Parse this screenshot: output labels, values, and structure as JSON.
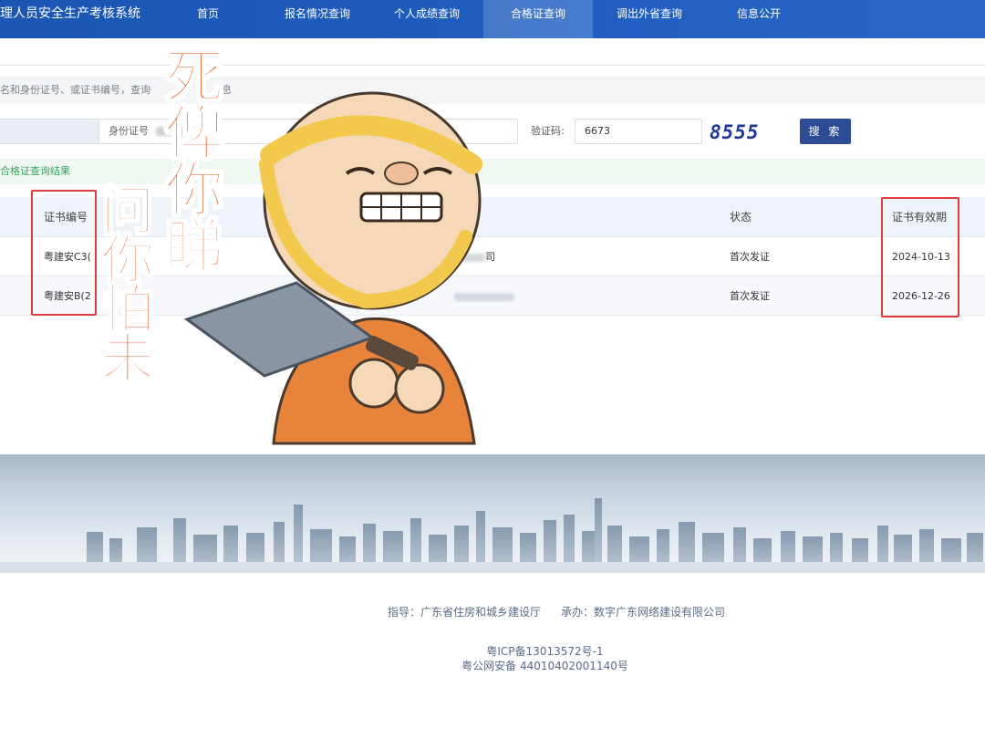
{
  "header": {
    "title": "理人员安全生产考核系统",
    "nav": [
      {
        "label": "首页",
        "active": false
      },
      {
        "label": "报名情况查询",
        "active": false
      },
      {
        "label": "个人成绩查询",
        "active": false
      },
      {
        "label": "合格证查询",
        "active": true
      },
      {
        "label": "调出外省查询",
        "active": false
      },
      {
        "label": "信息公开",
        "active": false
      }
    ]
  },
  "search": {
    "hint": "名和身份证号、或证书编号，查询",
    "hint_tail": "息",
    "id_field_prefix": "身份证号",
    "captcha_label": "验证码:",
    "captcha_value": "6673",
    "captcha_image_text": "8555",
    "search_button": "搜 索"
  },
  "result": {
    "banner": "合格证查询结果",
    "columns": {
      "cert_no": "证书编号",
      "status": "状态",
      "valid_until": "证书有效期"
    },
    "rows": [
      {
        "cert_no": "粤建安C3(",
        "company_tail": "司",
        "status": "首次发证",
        "valid_until": "2024-10-13"
      },
      {
        "cert_no": "粤建安B(2",
        "company_tail": "",
        "status": "首次发证",
        "valid_until": "2026-12-26"
      }
    ]
  },
  "meme": {
    "big_text": "死俾你睇",
    "side_text": "问你怕未"
  },
  "footer": {
    "guide_label": "指导：",
    "guide": "广东省住房和城乡建设厅",
    "host_label": "承办：",
    "host": "数字广东网络建设有限公司",
    "icp": "粤ICP备13013572号-1",
    "police": "粤公网安备 44010402001140号"
  },
  "colors": {
    "nav": "#1f5ec0",
    "search_button": "#2c4c96",
    "highlight_box": "#e23b3b",
    "meme_text": "#e45a1e"
  }
}
